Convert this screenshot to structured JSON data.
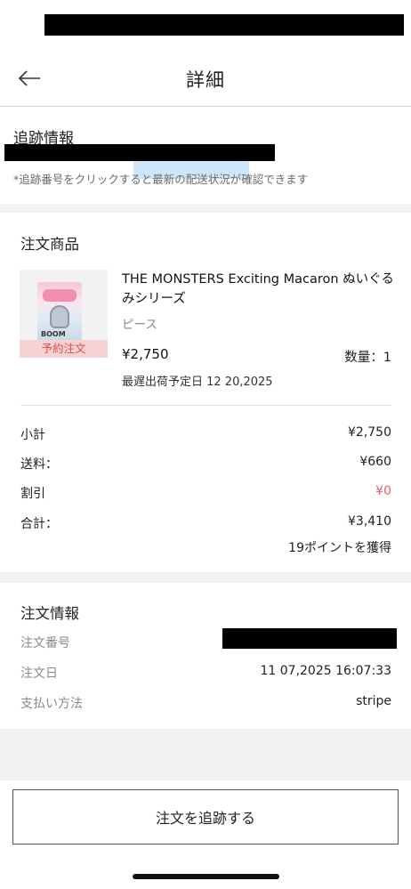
{
  "header": {
    "title": "詳細",
    "back_icon": "arrow-left-icon"
  },
  "tracking": {
    "title": "追跡情報",
    "note": "*追跡番号をクリックすると最新の配送状況が確認できます"
  },
  "order_items": {
    "title": "注文商品",
    "product": {
      "name": "THE MONSTERS Exciting Macaron ぬいぐるみシリーズ",
      "variant": "ピース",
      "preorder_tag": "予約注文",
      "price": "¥2,750",
      "quantity": "数量：1",
      "ship_date": "最遅出荷予定日 12 20,2025"
    },
    "summary": {
      "subtotal_label": "小計",
      "subtotal_value": "¥2,750",
      "shipping_label": "送料：",
      "shipping_value": "¥660",
      "discount_label": "割引",
      "discount_value": "¥0",
      "total_label": "合計：",
      "total_value": "¥3,410",
      "points": "19ポイントを獲得"
    }
  },
  "order_info": {
    "title": "注文情報",
    "number_label": "注文番号",
    "date_label": "注文日",
    "date_value": "11 07,2025 16:07:33",
    "payment_label": "支払い方法",
    "payment_value": "stripe"
  },
  "footer": {
    "track_button": "注文を追跡する"
  },
  "colors": {
    "accent_discount": "#e4606f",
    "preorder_text": "#e04a4a",
    "preorder_bg": "#f6d3d3",
    "section_gap": "#f2f2f2"
  }
}
